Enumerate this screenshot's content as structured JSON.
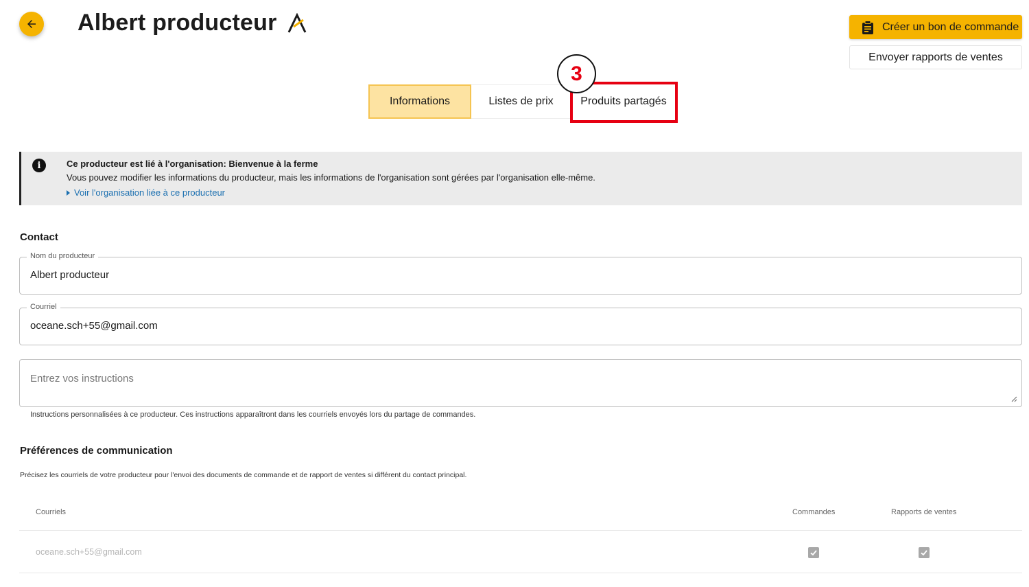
{
  "header": {
    "title": "Albert producteur",
    "back_icon": "arrow-left-icon",
    "logo_icon": "brand-logo-icon"
  },
  "actions": {
    "create_order_label": "Créer un bon de commande",
    "create_order_icon": "clipboard-icon",
    "send_reports_label": "Envoyer rapports de ventes"
  },
  "tabs": [
    {
      "label": "Informations",
      "active": true
    },
    {
      "label": "Listes de prix",
      "active": false
    },
    {
      "label": "Produits partagés",
      "active": false
    }
  ],
  "annotation": {
    "step_number": "3",
    "highlight_color": "#e60012"
  },
  "notice": {
    "icon": "info-icon",
    "title": "Ce producteur est lié à l'organisation: Bienvenue à la ferme",
    "text": "Vous pouvez modifier les informations du producteur, mais les informations de l'organisation sont gérées par l'organisation elle-même.",
    "link": "Voir l'organisation liée à ce producteur"
  },
  "contact": {
    "section_title": "Contact",
    "name_label": "Nom du producteur",
    "name_value": "Albert producteur",
    "email_label": "Courriel",
    "email_value": "oceane.sch+55@gmail.com",
    "instructions_placeholder": "Entrez vos instructions",
    "instructions_helper": "Instructions personnalisées à ce producteur. Ces instructions apparaîtront dans les courriels envoyés lors du partage de commandes."
  },
  "preferences": {
    "section_title": "Préférences de communication",
    "description": "Précisez les courriels de votre producteur pour l'envoi des documents de commande et de rapport de ventes si différent du contact principal.",
    "columns": [
      "Courriels",
      "Commandes",
      "Rapports de ventes"
    ],
    "rows": [
      {
        "email": "oceane.sch+55@gmail.com",
        "orders": true,
        "sales_reports": true
      }
    ]
  },
  "colors": {
    "accent": "#f5b300",
    "tab_active_bg": "#fde3a2",
    "link": "#1a6fb0",
    "notice_bg": "#ebebeb"
  }
}
